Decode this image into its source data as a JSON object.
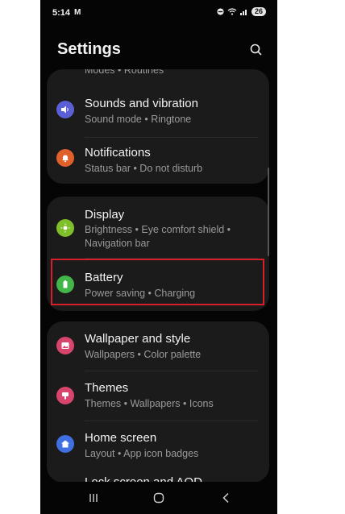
{
  "status_bar": {
    "time": "5:14",
    "mail": "M",
    "battery": "26"
  },
  "header": {
    "title": "Settings"
  },
  "partial_item": {
    "sub": "Modes  •  Routines"
  },
  "items": [
    {
      "label": "Sounds and vibration",
      "sub": "Sound mode  •  Ringtone",
      "icon": "volume-icon",
      "color": "#5a5fd6"
    },
    {
      "label": "Notifications",
      "sub": "Status bar  •  Do not disturb",
      "icon": "bell-icon",
      "color": "#e0612b"
    },
    {
      "label": "Display",
      "sub": "Brightness  •  Eye comfort shield  •",
      "sub2": "Navigation bar",
      "icon": "sun-icon",
      "color": "#7fbf2a"
    },
    {
      "label": "Battery",
      "sub": "Power saving  •  Charging",
      "icon": "battery-icon",
      "color": "#43b64a"
    },
    {
      "label": "Wallpaper and style",
      "sub": "Wallpapers  •  Color palette",
      "icon": "image-icon",
      "color": "#d8456c"
    },
    {
      "label": "Themes",
      "sub": "Themes  •  Wallpapers  •  Icons",
      "icon": "theme-icon",
      "color": "#d8456c"
    },
    {
      "label": "Home screen",
      "sub": "Layout  •  App icon badges",
      "icon": "home-icon",
      "color": "#3f6fe0"
    }
  ],
  "partial_bottom": {
    "label": "Lock screen and AOD"
  }
}
